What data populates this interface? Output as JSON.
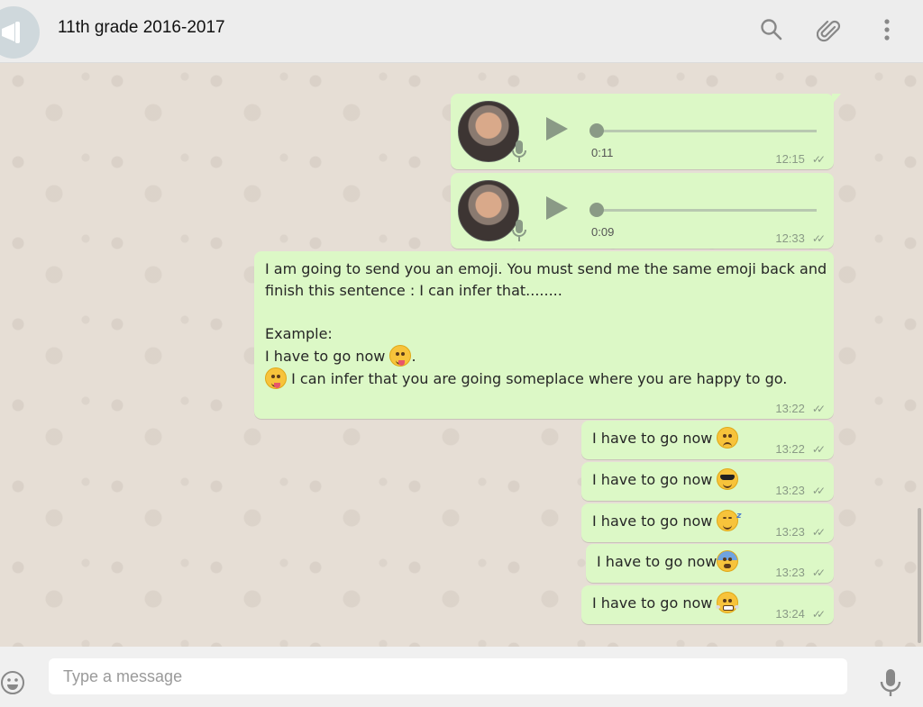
{
  "header": {
    "title": "11th grade 2016-2017",
    "icons": [
      "megaphone-icon",
      "search-icon",
      "paperclip-icon",
      "more-vertical-icon"
    ]
  },
  "messages": {
    "voice": [
      {
        "duration": "0:11",
        "time": "12:15"
      },
      {
        "duration": "0:09",
        "time": "12:33"
      }
    ],
    "prompt": {
      "line1": "I am going to send you an emoji. You must send me the same emoji back and",
      "line2": "finish this sentence : I can infer that........",
      "line3": "Example:",
      "line4": "I have to go now",
      "line4_end": ".",
      "line5": "I can infer that you are going someplace where you are happy to go.",
      "time": "13:22"
    },
    "replies": [
      {
        "text": "I have to go now ",
        "emoji": "disappointed-face",
        "time": "13:22"
      },
      {
        "text": "I have to go now ",
        "emoji": "sunglasses-face",
        "time": "13:23"
      },
      {
        "text": "I have to go now ",
        "emoji": "sleeping-face",
        "time": "13:23"
      },
      {
        "text": "I have to go now",
        "emoji": "fearful-face",
        "time": "13:23"
      },
      {
        "text": "I have to go now ",
        "emoji": "steam-face",
        "time": "13:24"
      }
    ]
  },
  "composer": {
    "placeholder": "Type a message"
  },
  "colors": {
    "bubble": "#dcf8c6",
    "header": "#ededed",
    "chat_background": "#e6ded5"
  }
}
